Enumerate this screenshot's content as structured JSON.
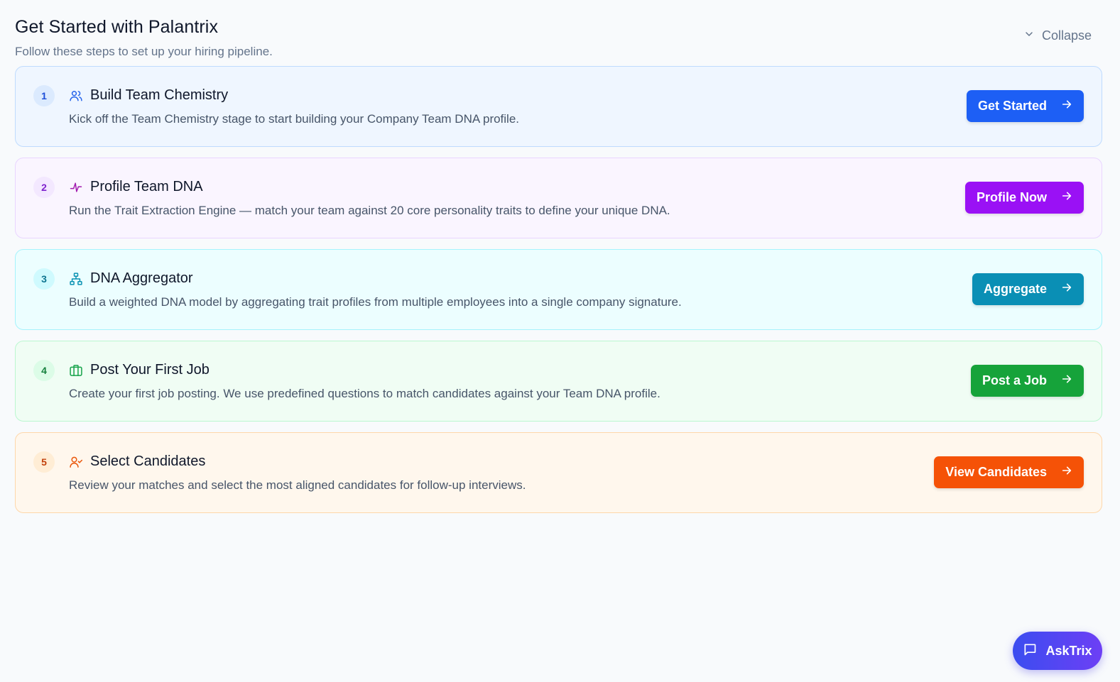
{
  "header": {
    "title": "Get Started with Palantrix",
    "subtitle": "Follow these steps to set up your hiring pipeline.",
    "collapse_label": "Collapse"
  },
  "steps": [
    {
      "number": "1",
      "icon": "users-icon",
      "title": "Build Team Chemistry",
      "description": "Kick off the Team Chemistry stage to start building your Company Team DNA profile.",
      "button_label": "Get Started",
      "colors": {
        "bg": "#eff6ff",
        "border": "#bfdbfe",
        "badge_bg": "#dbeafe",
        "badge_text": "#1d4ed8",
        "icon": "#2563eb",
        "button": "#1d5ff5"
      }
    },
    {
      "number": "2",
      "icon": "sparkle-icon",
      "title": "Profile Team DNA",
      "description": "Run the Trait Extraction Engine — match your team against 20 core personality traits to define your unique DNA.",
      "button_label": "Profile Now",
      "colors": {
        "bg": "#faf5ff",
        "border": "#e9d5ff",
        "badge_bg": "#f3e8ff",
        "badge_text": "#7e22ce",
        "icon": "#a21caf",
        "button": "#9a11f5"
      }
    },
    {
      "number": "3",
      "icon": "network-icon",
      "title": "DNA Aggregator",
      "description": "Build a weighted DNA model by aggregating trait profiles from multiple employees into a single company signature.",
      "button_label": "Aggregate",
      "colors": {
        "bg": "#ecfeff",
        "border": "#a5f3fc",
        "badge_bg": "#cffafe",
        "badge_text": "#0e7490",
        "icon": "#0891b2",
        "button": "#0a8fb5"
      }
    },
    {
      "number": "4",
      "icon": "briefcase-icon",
      "title": "Post Your First Job",
      "description": "Create your first job posting. We use predefined questions to match candidates against your Team DNA profile.",
      "button_label": "Post a Job",
      "colors": {
        "bg": "#f0fdf4",
        "border": "#bbf7d0",
        "badge_bg": "#dcfce7",
        "badge_text": "#15803d",
        "icon": "#16a34a",
        "button": "#16a33a"
      }
    },
    {
      "number": "5",
      "icon": "user-check-icon",
      "title": "Select Candidates",
      "description": "Review your matches and select the most aligned candidates for follow-up interviews.",
      "button_label": "View Candidates",
      "colors": {
        "bg": "#fff7ed",
        "border": "#fed7aa",
        "badge_bg": "#ffedd5",
        "badge_text": "#c2410c",
        "icon": "#ea580c",
        "button": "#f55207"
      }
    }
  ],
  "asktrix": {
    "label": "AskTrix",
    "icon": "chat-icon"
  }
}
